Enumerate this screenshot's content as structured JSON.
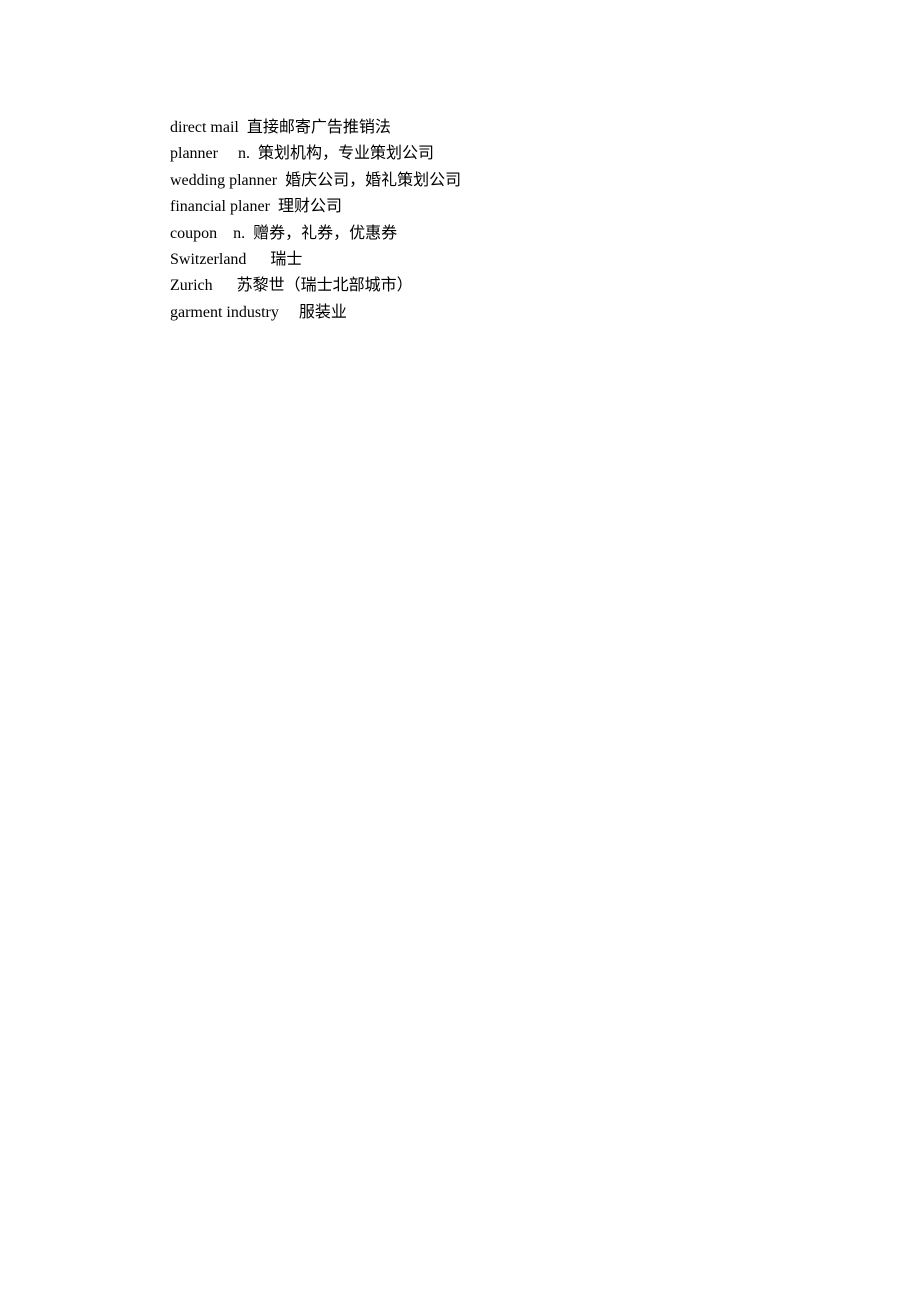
{
  "vocabulary": {
    "entries": [
      {
        "text": "direct mail  直接邮寄广告推销法"
      },
      {
        "text": "planner     n.  策划机构，专业策划公司"
      },
      {
        "text": "wedding planner  婚庆公司，婚礼策划公司"
      },
      {
        "text": "financial planer  理财公司"
      },
      {
        "text": "coupon    n.  赠券，礼券，优惠券"
      },
      {
        "text": "Switzerland      瑞士"
      },
      {
        "text": "Zurich      苏黎世（瑞士北部城市）"
      },
      {
        "text": "garment industry     服装业"
      }
    ]
  }
}
